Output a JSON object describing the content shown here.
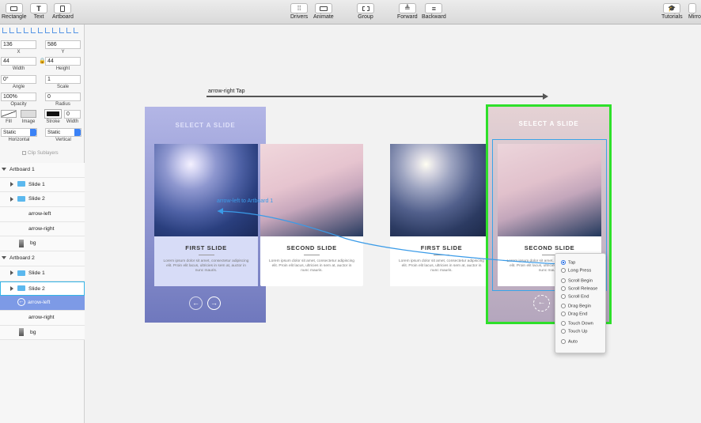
{
  "toolbar": {
    "left": [
      "Rectangle",
      "Text",
      "Artboard"
    ],
    "center": [
      "Drivers",
      "Animate",
      "Group"
    ],
    "arrange": [
      "Forward",
      "Backward"
    ],
    "right": [
      "Tutorials",
      "Mirro"
    ]
  },
  "inspector": {
    "x": {
      "value": "136",
      "label": "X"
    },
    "y": {
      "value": "586",
      "label": "Y"
    },
    "width": {
      "value": "44",
      "label": "Width"
    },
    "height": {
      "value": "44",
      "label": "Height"
    },
    "angle": {
      "value": "0°",
      "label": "Angle"
    },
    "scale": {
      "value": "1",
      "label": "Scale"
    },
    "opacity": {
      "value": "100%",
      "label": "Opacity"
    },
    "radius": {
      "value": "0",
      "label": "Radius"
    },
    "fill_label": "Fill",
    "image_label": "Image",
    "stroke_label": "Stroke",
    "stroke_width": {
      "value": "0",
      "label": "Width"
    },
    "horizontal": {
      "value": "Static",
      "label": "Horizontal"
    },
    "vertical": {
      "value": "Static",
      "label": "Vertical"
    },
    "clip_sublayers": "Clip Sublayers"
  },
  "layers": [
    {
      "label": "Artboard 1",
      "level": 0,
      "kind": "artboard"
    },
    {
      "label": "Slide 1",
      "level": 1,
      "kind": "folder"
    },
    {
      "label": "Slide 2",
      "level": 1,
      "kind": "folder"
    },
    {
      "label": "arrow-left",
      "level": 1,
      "kind": "layer"
    },
    {
      "label": "arrow-right",
      "level": 1,
      "kind": "layer"
    },
    {
      "label": "bg",
      "level": 1,
      "kind": "bg"
    },
    {
      "label": "Artboard 2",
      "level": 0,
      "kind": "artboard"
    },
    {
      "label": "Slide 1",
      "level": 1,
      "kind": "folder"
    },
    {
      "label": "Slide 2",
      "level": 1,
      "kind": "folder",
      "state": "outlined"
    },
    {
      "label": "arrow-left",
      "level": 1,
      "kind": "arrow",
      "state": "selected"
    },
    {
      "label": "arrow-right",
      "level": 1,
      "kind": "layer"
    },
    {
      "label": "bg",
      "level": 1,
      "kind": "bg"
    }
  ],
  "canvas": {
    "top_connection_label": "arrow-right Tap",
    "back_connection_label": "arrow-left to Artboard 1",
    "artboard1": {
      "heading": "SELECT A SLIDE"
    },
    "artboard2": {
      "heading": "SELECT A SLIDE"
    },
    "slides": {
      "first_title": "FIRST SLIDE",
      "second_title": "SECOND SLIDE",
      "body": "Lorem ipsum dolor sit amet, consectetur adipiscing elit. Proin elit lacus, ultricies in sem at, auctor in nunc mauris."
    },
    "colors": {
      "selection_green": "#2ee02a",
      "link_blue": "#3a9be8",
      "artboard1_bg": "#7d86c6",
      "artboard2_bg": "#c9b7c6"
    }
  },
  "trigger_menu": {
    "options": [
      "Tap",
      "Long Press",
      "Scroll Begin",
      "Scroll Release",
      "Scroll End",
      "Drag Begin",
      "Drag End",
      "Touch Down",
      "Touch Up",
      "Auto"
    ],
    "selected": "Tap"
  }
}
